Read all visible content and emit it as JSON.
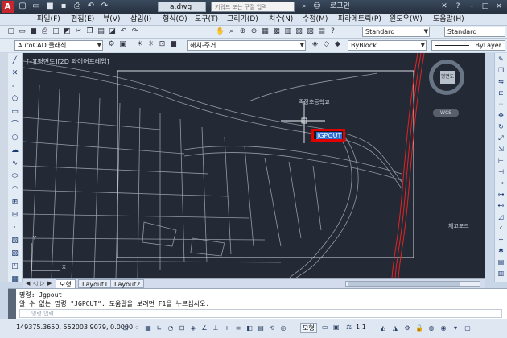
{
  "title": {
    "doc_tab": "a.dwg",
    "search_placeholder": "키워드 또는 구절 입력",
    "login": "로그인"
  },
  "menu": [
    "파일(F)",
    "편집(E)",
    "뷰(V)",
    "삽입(I)",
    "형식(O)",
    "도구(T)",
    "그리기(D)",
    "치수(N)",
    "수정(M)",
    "파라메트릭(P)",
    "윈도우(W)",
    "도움말(H)"
  ],
  "toolbar": {
    "workspace": "AutoCAD 클래식",
    "layer": "해치-주거",
    "color": "ByBlock",
    "linetype": "ByLayer",
    "text_style": "Standard",
    "dim_style": "Standard"
  },
  "viewport": {
    "label": "[–][평면도][2D 와이어프레임]",
    "tooltip_command": "JGPOUT",
    "map_label_1": "죽장초등학교",
    "map_label_2": "체고포크",
    "viewcube_face": "평면도",
    "wcs_label": "WCS",
    "ucs_x": "X",
    "ucs_y": "Y"
  },
  "layout_tabs": {
    "model": "모형",
    "layout1": "Layout1",
    "layout2": "Layout2"
  },
  "command": {
    "line1": "명령: Jgpout",
    "line2": "알 수 없는 명령 \"JGPOUT\".  도움말을 보려면 F1을 누르십시오.",
    "input_placeholder": "명령 입력"
  },
  "status": {
    "coordinates": "149375.3650, 552003.9079, 0.0000",
    "model": "모형",
    "scale": "1:1"
  },
  "colors": {
    "canvas_bg": "#232a35",
    "tooltip_border": "#e00000",
    "highlight": "#2b6fd6"
  }
}
